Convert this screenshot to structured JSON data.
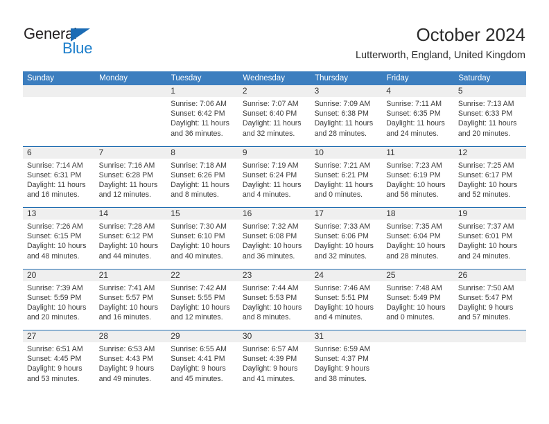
{
  "brand": {
    "name_part1": "General",
    "name_part2": "Blue",
    "triangle_icon": "triangle-icon",
    "color_dark": "#231f20",
    "color_blue": "#1c7ecb"
  },
  "header": {
    "title": "October 2024",
    "subtitle": "Lutterworth, England, United Kingdom"
  },
  "theme": {
    "header_row_bg": "#3c7ebf",
    "daynum_bg": "#efefef",
    "week_divider": "#1f6cb0",
    "text": "#3a3a3a"
  },
  "weekdays": [
    "Sunday",
    "Monday",
    "Tuesday",
    "Wednesday",
    "Thursday",
    "Friday",
    "Saturday"
  ],
  "weeks": [
    [
      {
        "day": "",
        "sunrise": "",
        "sunset": "",
        "daylight_line1": "",
        "daylight_line2": ""
      },
      {
        "day": "",
        "sunrise": "",
        "sunset": "",
        "daylight_line1": "",
        "daylight_line2": ""
      },
      {
        "day": "1",
        "sunrise": "Sunrise: 7:06 AM",
        "sunset": "Sunset: 6:42 PM",
        "daylight_line1": "Daylight: 11 hours",
        "daylight_line2": "and 36 minutes."
      },
      {
        "day": "2",
        "sunrise": "Sunrise: 7:07 AM",
        "sunset": "Sunset: 6:40 PM",
        "daylight_line1": "Daylight: 11 hours",
        "daylight_line2": "and 32 minutes."
      },
      {
        "day": "3",
        "sunrise": "Sunrise: 7:09 AM",
        "sunset": "Sunset: 6:38 PM",
        "daylight_line1": "Daylight: 11 hours",
        "daylight_line2": "and 28 minutes."
      },
      {
        "day": "4",
        "sunrise": "Sunrise: 7:11 AM",
        "sunset": "Sunset: 6:35 PM",
        "daylight_line1": "Daylight: 11 hours",
        "daylight_line2": "and 24 minutes."
      },
      {
        "day": "5",
        "sunrise": "Sunrise: 7:13 AM",
        "sunset": "Sunset: 6:33 PM",
        "daylight_line1": "Daylight: 11 hours",
        "daylight_line2": "and 20 minutes."
      }
    ],
    [
      {
        "day": "6",
        "sunrise": "Sunrise: 7:14 AM",
        "sunset": "Sunset: 6:31 PM",
        "daylight_line1": "Daylight: 11 hours",
        "daylight_line2": "and 16 minutes."
      },
      {
        "day": "7",
        "sunrise": "Sunrise: 7:16 AM",
        "sunset": "Sunset: 6:28 PM",
        "daylight_line1": "Daylight: 11 hours",
        "daylight_line2": "and 12 minutes."
      },
      {
        "day": "8",
        "sunrise": "Sunrise: 7:18 AM",
        "sunset": "Sunset: 6:26 PM",
        "daylight_line1": "Daylight: 11 hours",
        "daylight_line2": "and 8 minutes."
      },
      {
        "day": "9",
        "sunrise": "Sunrise: 7:19 AM",
        "sunset": "Sunset: 6:24 PM",
        "daylight_line1": "Daylight: 11 hours",
        "daylight_line2": "and 4 minutes."
      },
      {
        "day": "10",
        "sunrise": "Sunrise: 7:21 AM",
        "sunset": "Sunset: 6:21 PM",
        "daylight_line1": "Daylight: 11 hours",
        "daylight_line2": "and 0 minutes."
      },
      {
        "day": "11",
        "sunrise": "Sunrise: 7:23 AM",
        "sunset": "Sunset: 6:19 PM",
        "daylight_line1": "Daylight: 10 hours",
        "daylight_line2": "and 56 minutes."
      },
      {
        "day": "12",
        "sunrise": "Sunrise: 7:25 AM",
        "sunset": "Sunset: 6:17 PM",
        "daylight_line1": "Daylight: 10 hours",
        "daylight_line2": "and 52 minutes."
      }
    ],
    [
      {
        "day": "13",
        "sunrise": "Sunrise: 7:26 AM",
        "sunset": "Sunset: 6:15 PM",
        "daylight_line1": "Daylight: 10 hours",
        "daylight_line2": "and 48 minutes."
      },
      {
        "day": "14",
        "sunrise": "Sunrise: 7:28 AM",
        "sunset": "Sunset: 6:12 PM",
        "daylight_line1": "Daylight: 10 hours",
        "daylight_line2": "and 44 minutes."
      },
      {
        "day": "15",
        "sunrise": "Sunrise: 7:30 AM",
        "sunset": "Sunset: 6:10 PM",
        "daylight_line1": "Daylight: 10 hours",
        "daylight_line2": "and 40 minutes."
      },
      {
        "day": "16",
        "sunrise": "Sunrise: 7:32 AM",
        "sunset": "Sunset: 6:08 PM",
        "daylight_line1": "Daylight: 10 hours",
        "daylight_line2": "and 36 minutes."
      },
      {
        "day": "17",
        "sunrise": "Sunrise: 7:33 AM",
        "sunset": "Sunset: 6:06 PM",
        "daylight_line1": "Daylight: 10 hours",
        "daylight_line2": "and 32 minutes."
      },
      {
        "day": "18",
        "sunrise": "Sunrise: 7:35 AM",
        "sunset": "Sunset: 6:04 PM",
        "daylight_line1": "Daylight: 10 hours",
        "daylight_line2": "and 28 minutes."
      },
      {
        "day": "19",
        "sunrise": "Sunrise: 7:37 AM",
        "sunset": "Sunset: 6:01 PM",
        "daylight_line1": "Daylight: 10 hours",
        "daylight_line2": "and 24 minutes."
      }
    ],
    [
      {
        "day": "20",
        "sunrise": "Sunrise: 7:39 AM",
        "sunset": "Sunset: 5:59 PM",
        "daylight_line1": "Daylight: 10 hours",
        "daylight_line2": "and 20 minutes."
      },
      {
        "day": "21",
        "sunrise": "Sunrise: 7:41 AM",
        "sunset": "Sunset: 5:57 PM",
        "daylight_line1": "Daylight: 10 hours",
        "daylight_line2": "and 16 minutes."
      },
      {
        "day": "22",
        "sunrise": "Sunrise: 7:42 AM",
        "sunset": "Sunset: 5:55 PM",
        "daylight_line1": "Daylight: 10 hours",
        "daylight_line2": "and 12 minutes."
      },
      {
        "day": "23",
        "sunrise": "Sunrise: 7:44 AM",
        "sunset": "Sunset: 5:53 PM",
        "daylight_line1": "Daylight: 10 hours",
        "daylight_line2": "and 8 minutes."
      },
      {
        "day": "24",
        "sunrise": "Sunrise: 7:46 AM",
        "sunset": "Sunset: 5:51 PM",
        "daylight_line1": "Daylight: 10 hours",
        "daylight_line2": "and 4 minutes."
      },
      {
        "day": "25",
        "sunrise": "Sunrise: 7:48 AM",
        "sunset": "Sunset: 5:49 PM",
        "daylight_line1": "Daylight: 10 hours",
        "daylight_line2": "and 0 minutes."
      },
      {
        "day": "26",
        "sunrise": "Sunrise: 7:50 AM",
        "sunset": "Sunset: 5:47 PM",
        "daylight_line1": "Daylight: 9 hours",
        "daylight_line2": "and 57 minutes."
      }
    ],
    [
      {
        "day": "27",
        "sunrise": "Sunrise: 6:51 AM",
        "sunset": "Sunset: 4:45 PM",
        "daylight_line1": "Daylight: 9 hours",
        "daylight_line2": "and 53 minutes."
      },
      {
        "day": "28",
        "sunrise": "Sunrise: 6:53 AM",
        "sunset": "Sunset: 4:43 PM",
        "daylight_line1": "Daylight: 9 hours",
        "daylight_line2": "and 49 minutes."
      },
      {
        "day": "29",
        "sunrise": "Sunrise: 6:55 AM",
        "sunset": "Sunset: 4:41 PM",
        "daylight_line1": "Daylight: 9 hours",
        "daylight_line2": "and 45 minutes."
      },
      {
        "day": "30",
        "sunrise": "Sunrise: 6:57 AM",
        "sunset": "Sunset: 4:39 PM",
        "daylight_line1": "Daylight: 9 hours",
        "daylight_line2": "and 41 minutes."
      },
      {
        "day": "31",
        "sunrise": "Sunrise: 6:59 AM",
        "sunset": "Sunset: 4:37 PM",
        "daylight_line1": "Daylight: 9 hours",
        "daylight_line2": "and 38 minutes."
      },
      {
        "day": "",
        "sunrise": "",
        "sunset": "",
        "daylight_line1": "",
        "daylight_line2": ""
      },
      {
        "day": "",
        "sunrise": "",
        "sunset": "",
        "daylight_line1": "",
        "daylight_line2": ""
      }
    ]
  ]
}
